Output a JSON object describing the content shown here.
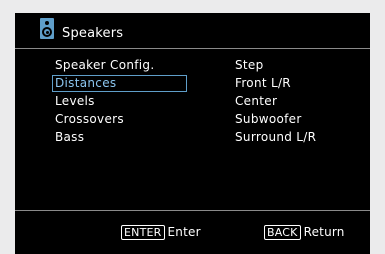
{
  "header": {
    "title": "Speakers",
    "icon": "speaker-icon",
    "icon_color": "#5f9ec9"
  },
  "menu": {
    "items": [
      {
        "label": "Speaker Config."
      },
      {
        "label": "Distances"
      },
      {
        "label": "Levels"
      },
      {
        "label": "Crossovers"
      },
      {
        "label": "Bass"
      }
    ],
    "selected": "Distances",
    "selected_color": "#8cc6f0"
  },
  "info": {
    "lines": [
      "Step",
      "Front L/R",
      "Center",
      "Subwoofer",
      "Surround L/R"
    ]
  },
  "footer": {
    "enter_key": "ENTER",
    "enter_label": "Enter",
    "back_key": "BACK",
    "back_label": "Return"
  }
}
